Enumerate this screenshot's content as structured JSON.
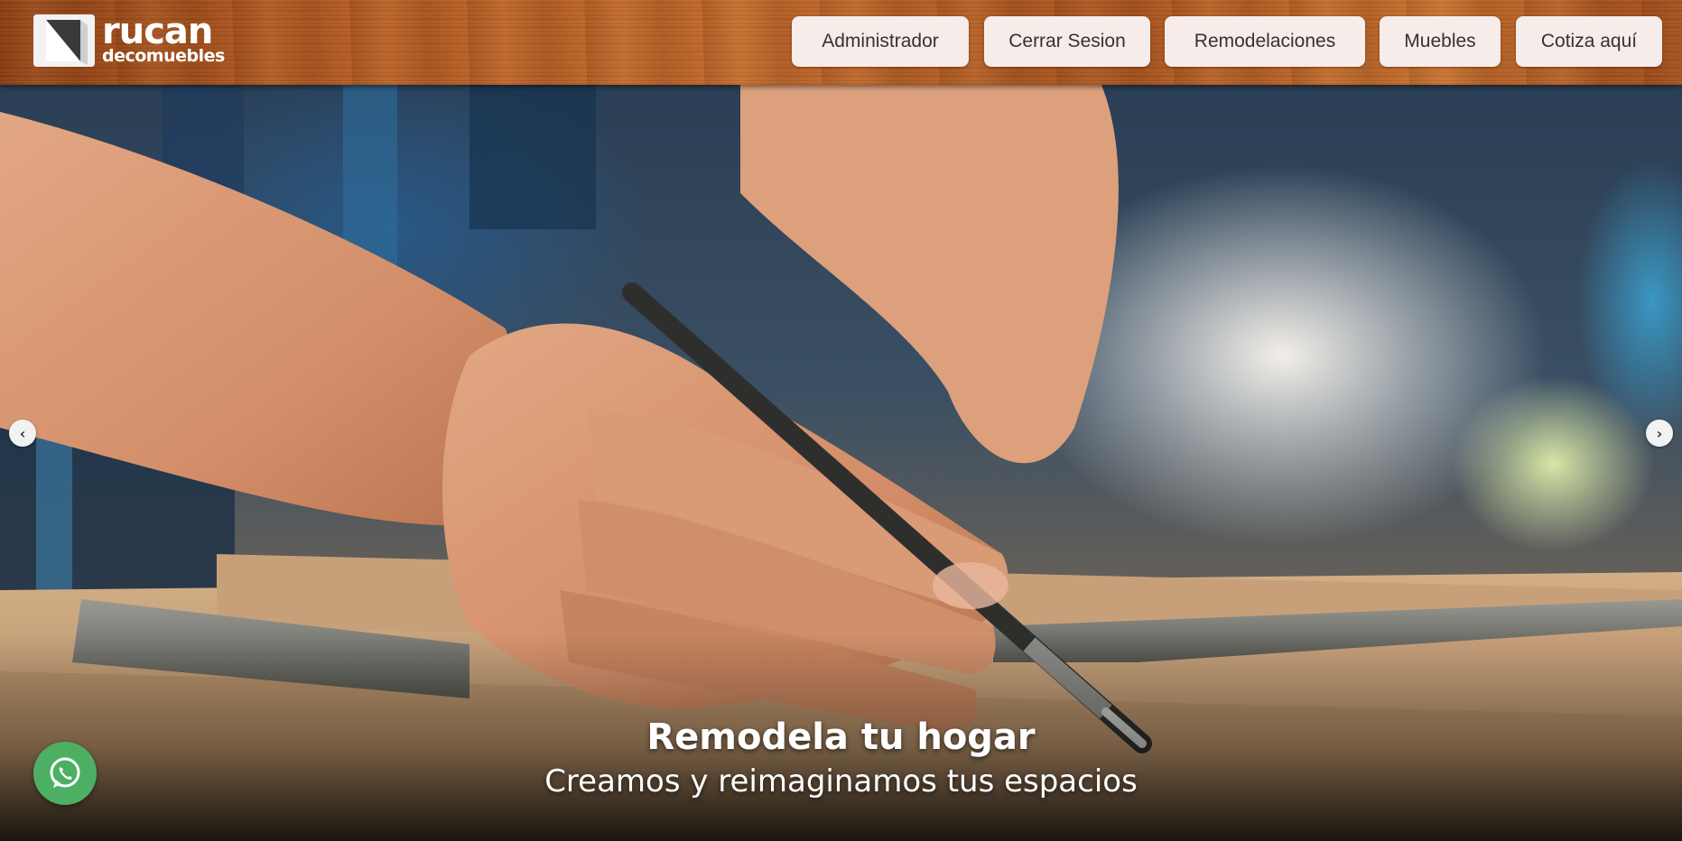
{
  "brand": {
    "name": "rucan",
    "tagline": "decomuebles"
  },
  "nav": [
    {
      "label": "Administrador"
    },
    {
      "label": "Cerrar Sesion"
    },
    {
      "label": "Remodelaciones"
    },
    {
      "label": "Muebles"
    },
    {
      "label": "Cotiza aquí"
    }
  ],
  "hero": {
    "title": "Remodela tu hogar",
    "subtitle": "Creamos y reimaginamos tus espacios",
    "prev_icon": "chevron-left-icon",
    "next_icon": "chevron-right-icon"
  },
  "floating": {
    "icon": "whatsapp-icon",
    "color": "#4caf63"
  },
  "colors": {
    "header_wood": "#b35a22",
    "nav_button_bg": "#f6ecea"
  }
}
